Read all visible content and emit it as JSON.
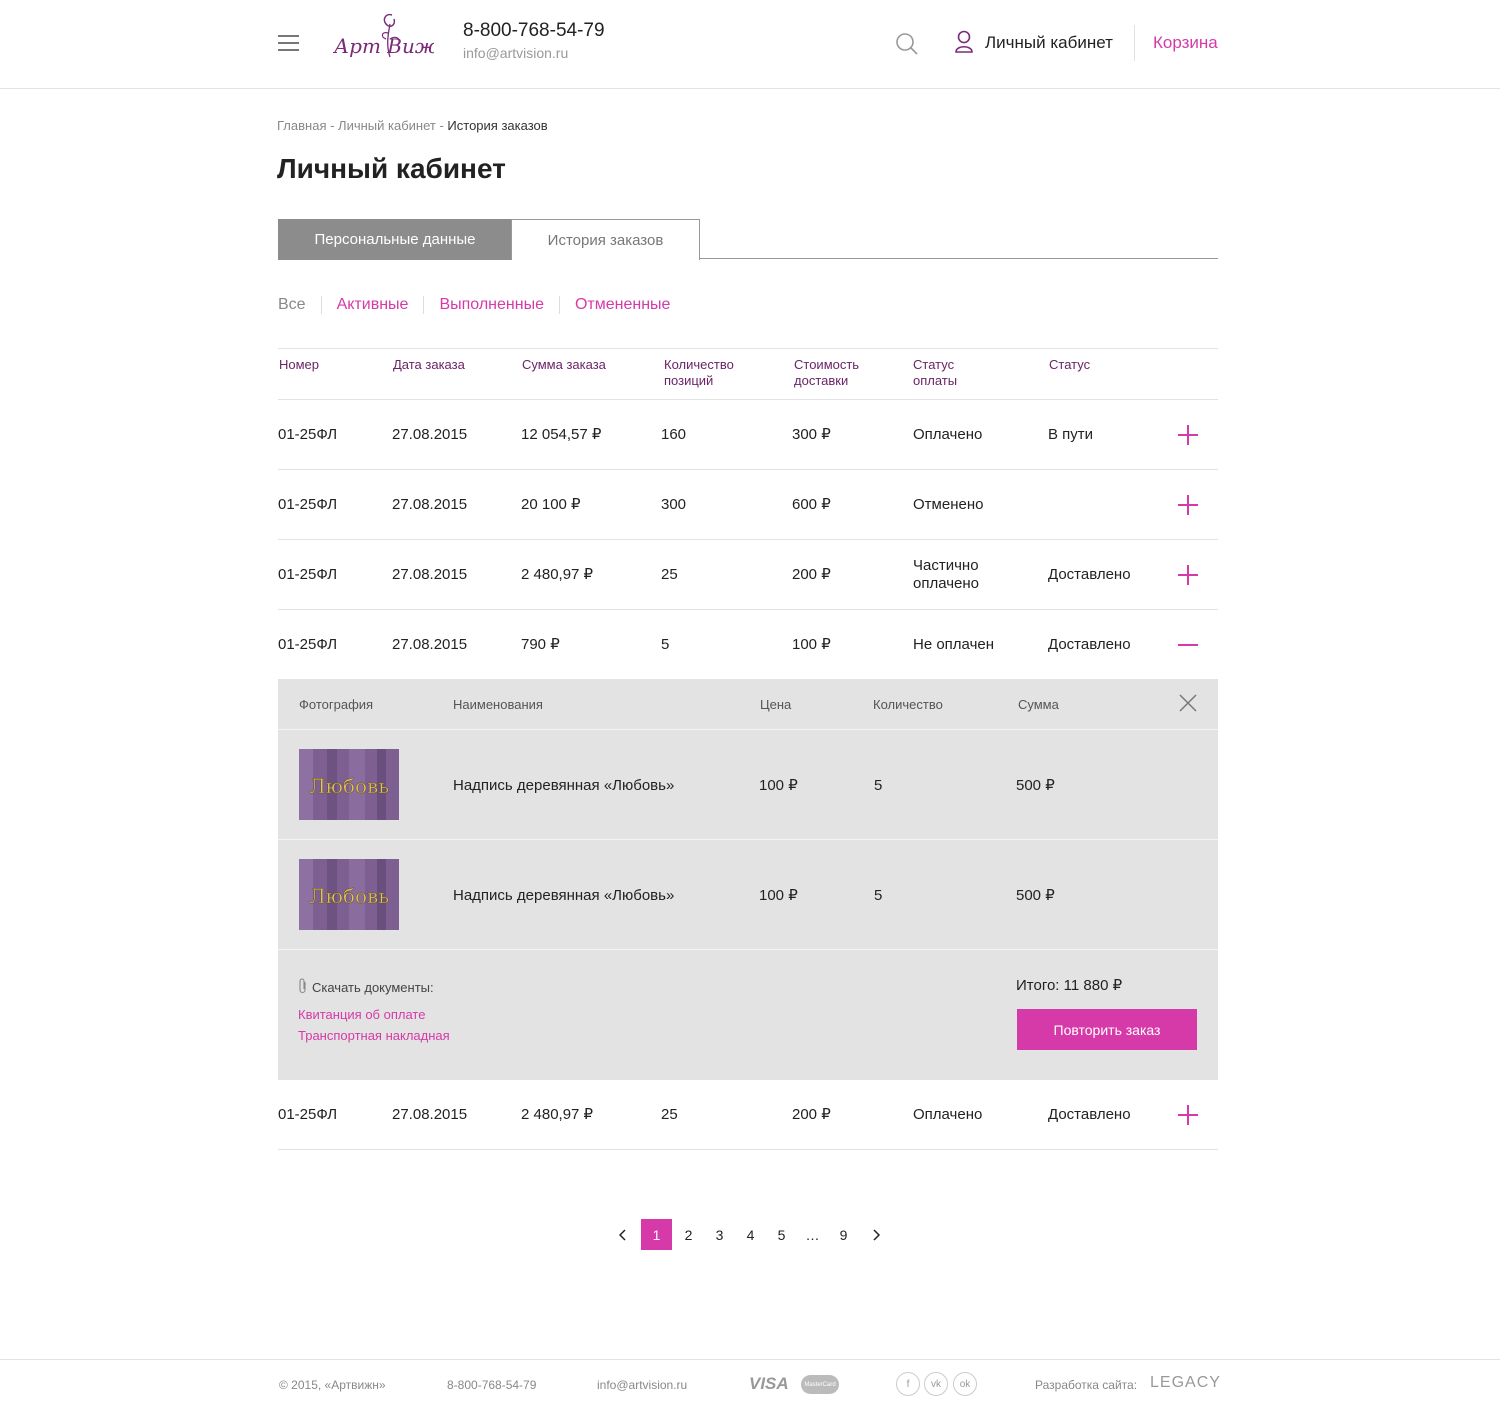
{
  "header": {
    "phone": "8-800-768-54-79",
    "email": "info@artvision.ru",
    "cabinet_label": "Личный кабинет",
    "cart_label": "Корзина",
    "logo_text": "Арт Вижн"
  },
  "breadcrumb": {
    "items": [
      "Главная",
      "Личный кабинет"
    ],
    "separator": " - ",
    "current": "История заказов"
  },
  "page_title": "Личный кабинет",
  "tabs": [
    "Персональные данные",
    "История заказов"
  ],
  "filters": [
    "Все",
    "Активные",
    "Выполненные",
    "Отмененные"
  ],
  "table": {
    "headers": [
      "Номер",
      "Дата заказа",
      "Сумма заказа",
      "Количество\nпозиций",
      "Стоимость\nдоставки",
      "Статус\nоплаты",
      "Статус"
    ],
    "rows": [
      {
        "number": "01-25ФЛ",
        "date": "27.08.2015",
        "sum": "12 054,57 ₽",
        "qty": "160",
        "delivery": "300 ₽",
        "payment": "Оплачено",
        "status": "В пути",
        "expanded": false
      },
      {
        "number": "01-25ФЛ",
        "date": "27.08.2015",
        "sum": "20 100 ₽",
        "qty": "300",
        "delivery": "600 ₽",
        "payment": "Отменено",
        "status": "",
        "expanded": false
      },
      {
        "number": "01-25ФЛ",
        "date": "27.08.2015",
        "sum": "2 480,97 ₽",
        "qty": "25",
        "delivery": "200 ₽",
        "payment": "Частично\nоплачено",
        "status": "Доставлено",
        "expanded": false
      },
      {
        "number": "01-25ФЛ",
        "date": "27.08.2015",
        "sum": "790 ₽",
        "qty": "5",
        "delivery": "100 ₽",
        "payment": "Не оплачен",
        "status": "Доставлено",
        "expanded": true
      },
      {
        "number": "01-25ФЛ",
        "date": "27.08.2015",
        "sum": "2 480,97 ₽",
        "qty": "25",
        "delivery": "200 ₽",
        "payment": "Оплачено",
        "status": "Доставлено",
        "expanded": false
      }
    ]
  },
  "details": {
    "headers": [
      "Фотография",
      "Наименования",
      "Цена",
      "Количество",
      "Сумма"
    ],
    "items": [
      {
        "thumb_text": "Любовь",
        "name": "Надпись деревянная «Любовь»",
        "price": "100 ₽",
        "qty": "5",
        "sum": "500 ₽"
      },
      {
        "thumb_text": "Любовь",
        "name": "Надпись деревянная «Любовь»",
        "price": "100 ₽",
        "qty": "5",
        "sum": "500 ₽"
      }
    ],
    "download_label": "Скачать документы:",
    "documents": [
      "Квитанция об оплате",
      "Транспортная накладная"
    ],
    "total": "Итого: 11 880 ₽",
    "repeat_button": "Повторить заказ"
  },
  "pagination": {
    "pages": [
      "1",
      "2",
      "3",
      "4",
      "5",
      "…",
      "9"
    ],
    "current": "1"
  },
  "footer": {
    "copyright": "© 2015, «Артвижн»",
    "phone": "8-800-768-54-79",
    "email": "info@artvision.ru",
    "payments": [
      "VISA",
      "MasterCard"
    ],
    "socials": [
      "f",
      "vk",
      "ok"
    ],
    "dev_label": "Разработка сайта:",
    "dev_name": "LEGACY"
  },
  "colors": {
    "accent": "#d63aa8",
    "header_purple": "#6b2466",
    "tab_gray": "#8c8c8c",
    "panel_bg": "#e3e3e3"
  }
}
